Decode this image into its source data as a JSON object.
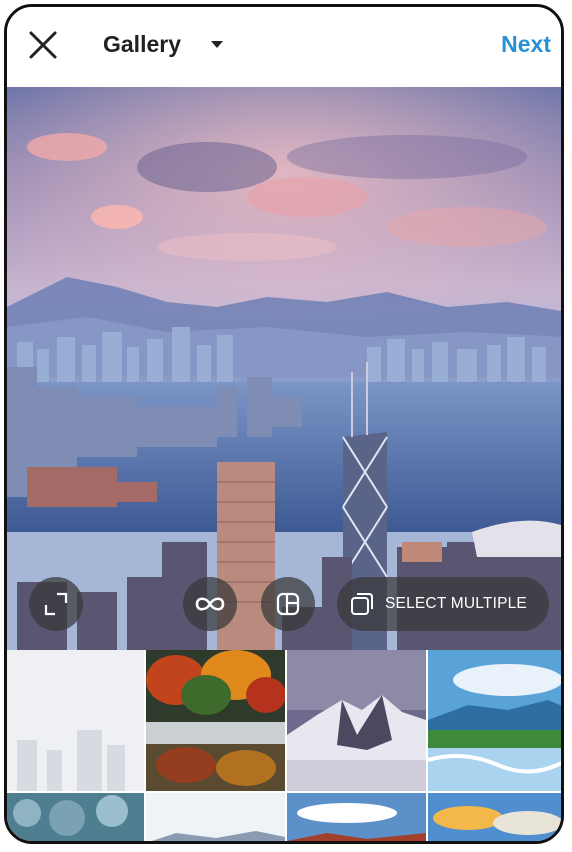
{
  "header": {
    "close_icon": "close-icon",
    "title": "Gallery",
    "dropdown_icon": "chevron-down-icon",
    "next_label": "Next"
  },
  "preview": {
    "image_subject": "city skyline at sunset"
  },
  "controls": {
    "expand_icon": "expand-icon",
    "boomerang_icon": "infinity-icon",
    "layout_icon": "layout-icon",
    "select_multiple_icon": "multiple-select-icon",
    "select_multiple_label": "SELECT MULTIPLE"
  },
  "colors": {
    "accent": "#2b8fd6",
    "control_bg": "#373737"
  }
}
